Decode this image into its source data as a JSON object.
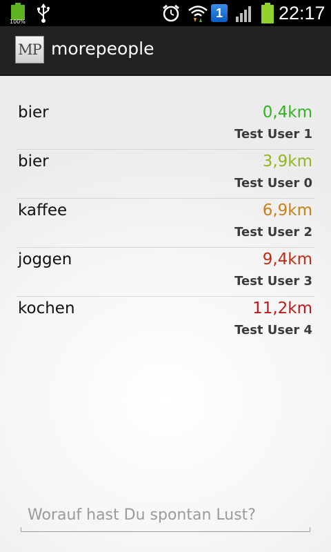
{
  "status_bar": {
    "battery_small_label": "100%",
    "notification_count": "1",
    "time": "22:17",
    "icons": [
      "battery-icon",
      "usb-icon",
      "alarm-icon",
      "wifi-icon",
      "notification-badge-icon",
      "signal-icon",
      "battery-icon"
    ]
  },
  "action_bar": {
    "logo_text": "MP",
    "title": "morepeople"
  },
  "activities": [
    {
      "name": "bier",
      "distance": "0,4km",
      "user": "Test User 1",
      "color": "#33b321"
    },
    {
      "name": "bier",
      "distance": "3,9km",
      "user": "Test User 0",
      "color": "#8fb81f"
    },
    {
      "name": "kaffee",
      "distance": "6,9km",
      "user": "Test User 2",
      "color": "#c87f16"
    },
    {
      "name": "joggen",
      "distance": "9,4km",
      "user": "Test User 3",
      "color": "#c22a14"
    },
    {
      "name": "kochen",
      "distance": "11,2km",
      "user": "Test User 4",
      "color": "#c01818"
    }
  ],
  "search": {
    "placeholder": "Worauf hast Du spontan Lust?",
    "value": ""
  }
}
